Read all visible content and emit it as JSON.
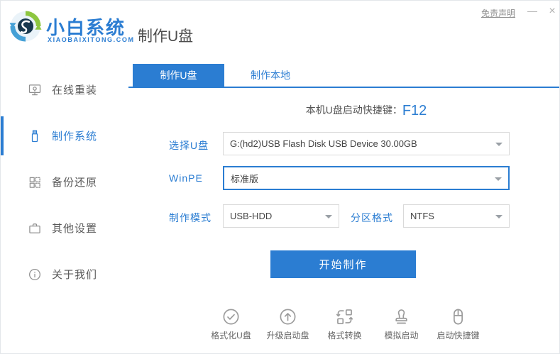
{
  "colors": {
    "accent": "#2b7dd2",
    "logo_green": "#8dc63f",
    "logo_blue": "#45a0d6",
    "logo_dark": "#17384e"
  },
  "brand": {
    "name": "小白系统",
    "domain": "XIAOBAIXITONG.COM"
  },
  "page_title": "制作U盘",
  "window_controls": {
    "disclaimer": "免责声明",
    "minimize": "—",
    "close": "×"
  },
  "sidebar": {
    "items": [
      {
        "label": "在线重装",
        "active": false
      },
      {
        "label": "制作系统",
        "active": true
      },
      {
        "label": "备份还原",
        "active": false
      },
      {
        "label": "其他设置",
        "active": false
      },
      {
        "label": "关于我们",
        "active": false
      }
    ]
  },
  "tabs": [
    {
      "label": "制作U盘",
      "active": true
    },
    {
      "label": "制作本地",
      "active": false
    }
  ],
  "hotkey": {
    "prefix": "本机U盘启动快捷键：",
    "key": "F12"
  },
  "form": {
    "usb": {
      "label": "选择U盘",
      "value": "G:(hd2)USB Flash Disk USB Device 30.00GB"
    },
    "winpe": {
      "label": "WinPE",
      "value": "标准版"
    },
    "mode": {
      "label": "制作模式",
      "value": "USB-HDD"
    },
    "partition": {
      "label": "分区格式",
      "value": "NTFS"
    }
  },
  "start_button": "开始制作",
  "toolbar": {
    "items": [
      {
        "label": "格式化U盘",
        "icon": "check-circle-icon"
      },
      {
        "label": "升级启动盘",
        "icon": "arrow-up-circle-icon"
      },
      {
        "label": "格式转换",
        "icon": "convert-icon"
      },
      {
        "label": "模拟启动",
        "icon": "stamp-icon"
      },
      {
        "label": "启动快捷键",
        "icon": "mouse-icon"
      }
    ]
  }
}
